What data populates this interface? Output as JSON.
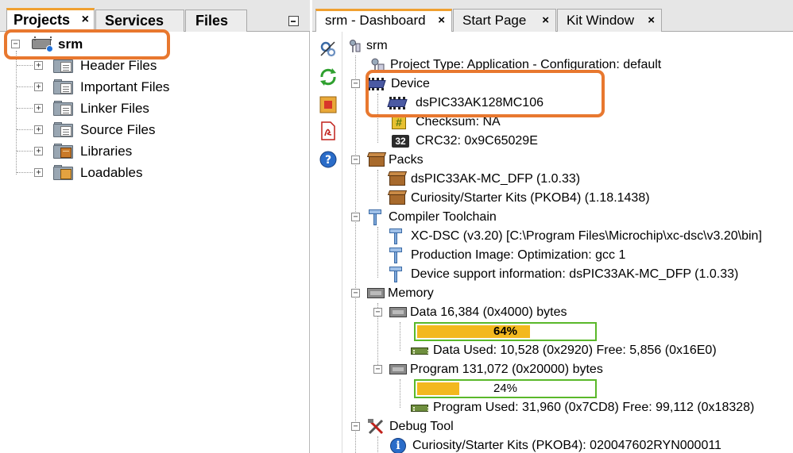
{
  "left_panel": {
    "tabs": [
      {
        "label": "Projects",
        "close": "×"
      },
      {
        "label": "Services"
      },
      {
        "label": "Files"
      }
    ],
    "project": {
      "name": "srm"
    },
    "items": [
      {
        "label": "Header Files"
      },
      {
        "label": "Important Files"
      },
      {
        "label": "Linker Files"
      },
      {
        "label": "Source Files"
      },
      {
        "label": "Libraries"
      },
      {
        "label": "Loadables"
      }
    ]
  },
  "right_panel": {
    "tabs": [
      {
        "label": "srm - Dashboard",
        "close": "×"
      },
      {
        "label": "Start Page",
        "close": "×"
      },
      {
        "label": "Kit Window",
        "close": "×"
      }
    ],
    "tree": {
      "root": "srm",
      "project_type": "Project Type: Application - Configuration: default",
      "device": {
        "label": "Device",
        "name": "dsPIC33AK128MC106",
        "checksum": "Checksum: NA",
        "crc32": "CRC32: 0x9C65029E"
      },
      "packs": {
        "label": "Packs",
        "items": [
          "dsPIC33AK-MC_DFP (1.0.33)",
          "Curiosity/Starter Kits (PKOB4) (1.18.1438)"
        ]
      },
      "compiler": {
        "label": "Compiler Toolchain",
        "items": [
          "XC-DSC (v3.20) [C:\\Program Files\\Microchip\\xc-dsc\\v3.20\\bin]",
          "Production Image: Optimization: gcc 1",
          " Device support information: dsPIC33AK-MC_DFP (1.0.33)"
        ]
      },
      "memory": {
        "label": "Memory",
        "data": {
          "label": "Data 16,384 (0x4000) bytes",
          "percent_label": "64%",
          "used_fraction": 0.64,
          "used": "Data Used: 10,528 (0x2920) Free: 5,856 (0x16E0)"
        },
        "program": {
          "label": "Program 131,072 (0x20000) bytes",
          "percent_label": "24%",
          "used_fraction": 0.24,
          "used": "Program Used: 31,960 (0x7CD8) Free: 99,112 (0x18328)"
        }
      },
      "debug": {
        "label": "Debug Tool",
        "items": [
          "Curiosity/Starter Kits (PKOB4): 020047602RYN000011"
        ]
      }
    },
    "toolbar": [
      "settings-icon",
      "refresh-icon",
      "stop-icon",
      "pdf-icon",
      "help-icon"
    ]
  },
  "colors": {
    "highlight": "#e8782f",
    "progress_fill": "#f3b81e",
    "progress_border": "#5ab82a",
    "active_tab_accent": "#f0a030"
  }
}
